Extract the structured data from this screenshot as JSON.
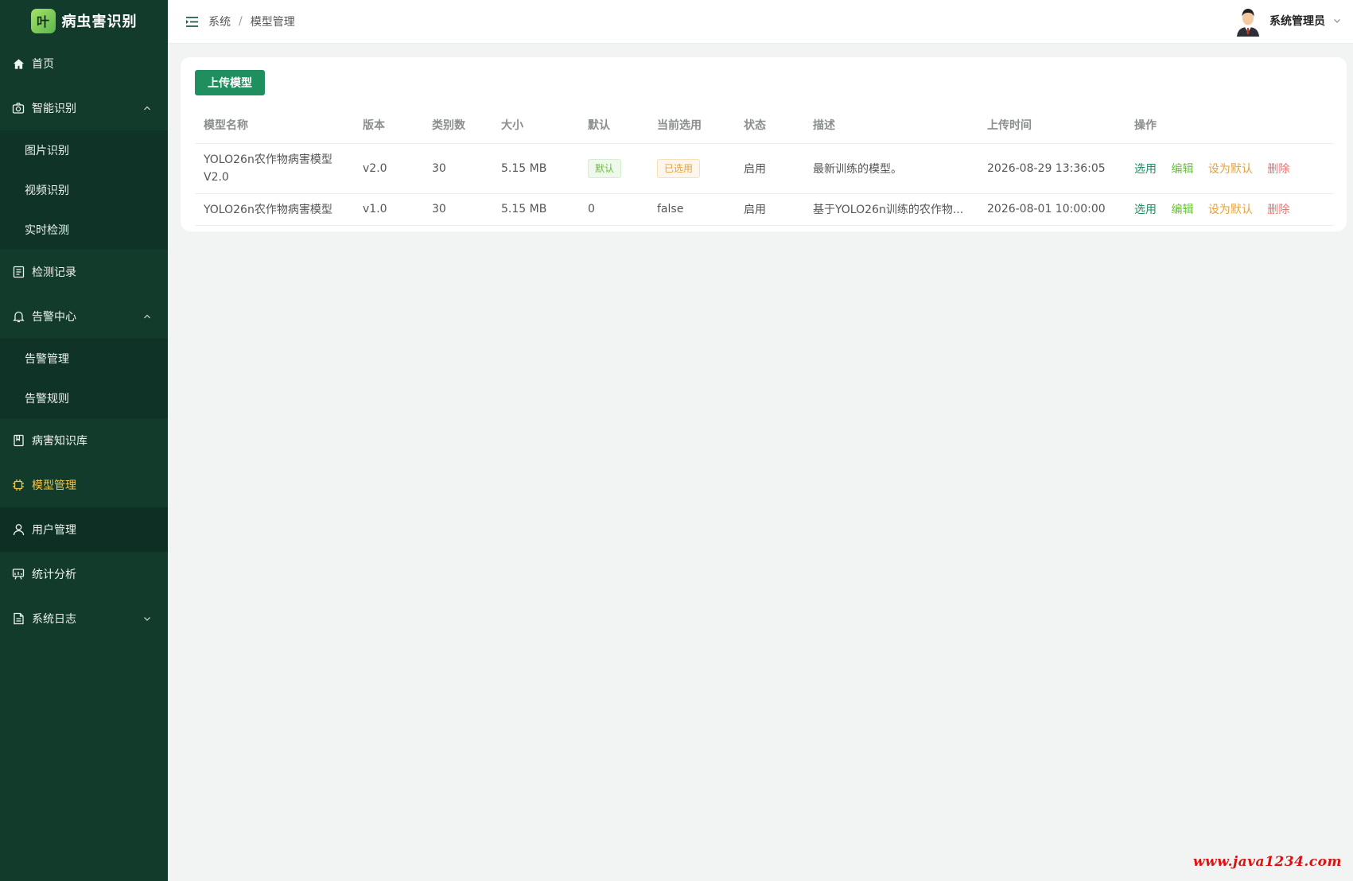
{
  "app": {
    "logo_char": "叶",
    "title": "病虫害识别"
  },
  "sidebar": {
    "items": [
      {
        "label": "首页",
        "icon": "home-icon"
      },
      {
        "label": "智能识别",
        "icon": "camera-icon",
        "expanded": true,
        "children": [
          {
            "label": "图片识别"
          },
          {
            "label": "视频识别"
          },
          {
            "label": "实时检测"
          }
        ]
      },
      {
        "label": "检测记录",
        "icon": "document-list-icon"
      },
      {
        "label": "告警中心",
        "icon": "bell-icon",
        "expanded": true,
        "children": [
          {
            "label": "告警管理"
          },
          {
            "label": "告警规则"
          }
        ]
      },
      {
        "label": "病害知识库",
        "icon": "book-icon"
      },
      {
        "label": "模型管理",
        "icon": "cpu-icon",
        "active": true
      },
      {
        "label": "用户管理",
        "icon": "user-icon"
      },
      {
        "label": "统计分析",
        "icon": "chart-board-icon"
      },
      {
        "label": "系统日志",
        "icon": "file-icon",
        "expanded": false
      }
    ],
    "active_color": "#f2c94c",
    "background": "#123b2c"
  },
  "header": {
    "breadcrumb": [
      "系统",
      "模型管理"
    ],
    "user_name": "系统管理员"
  },
  "main": {
    "upload_button": "上传模型",
    "table": {
      "columns": [
        "模型名称",
        "版本",
        "类别数",
        "大小",
        "默认",
        "当前选用",
        "状态",
        "描述",
        "上传时间",
        "操作"
      ],
      "rows": [
        {
          "name_line1": "YOLO26n农作物病害模型",
          "name_line2": "V2.0",
          "version": "v2.0",
          "classes": "30",
          "size": "5.15 MB",
          "default": "默认",
          "current": "已选用",
          "status": "启用",
          "description": "最新训练的模型。",
          "uploaded": "2026-08-29 13:36:05"
        },
        {
          "name_line1": "YOLO26n农作物病害模型",
          "version": "v1.0",
          "classes": "30",
          "size": "5.15 MB",
          "default": "0",
          "current": "false",
          "status": "启用",
          "description": "基于YOLO26n训练的农作物...",
          "uploaded": "2026-08-01 10:00:00"
        }
      ],
      "actions": {
        "select": "选用",
        "edit": "编辑",
        "set_default": "设为默认",
        "delete": "删除"
      }
    }
  },
  "watermark": "www.java1234.com"
}
